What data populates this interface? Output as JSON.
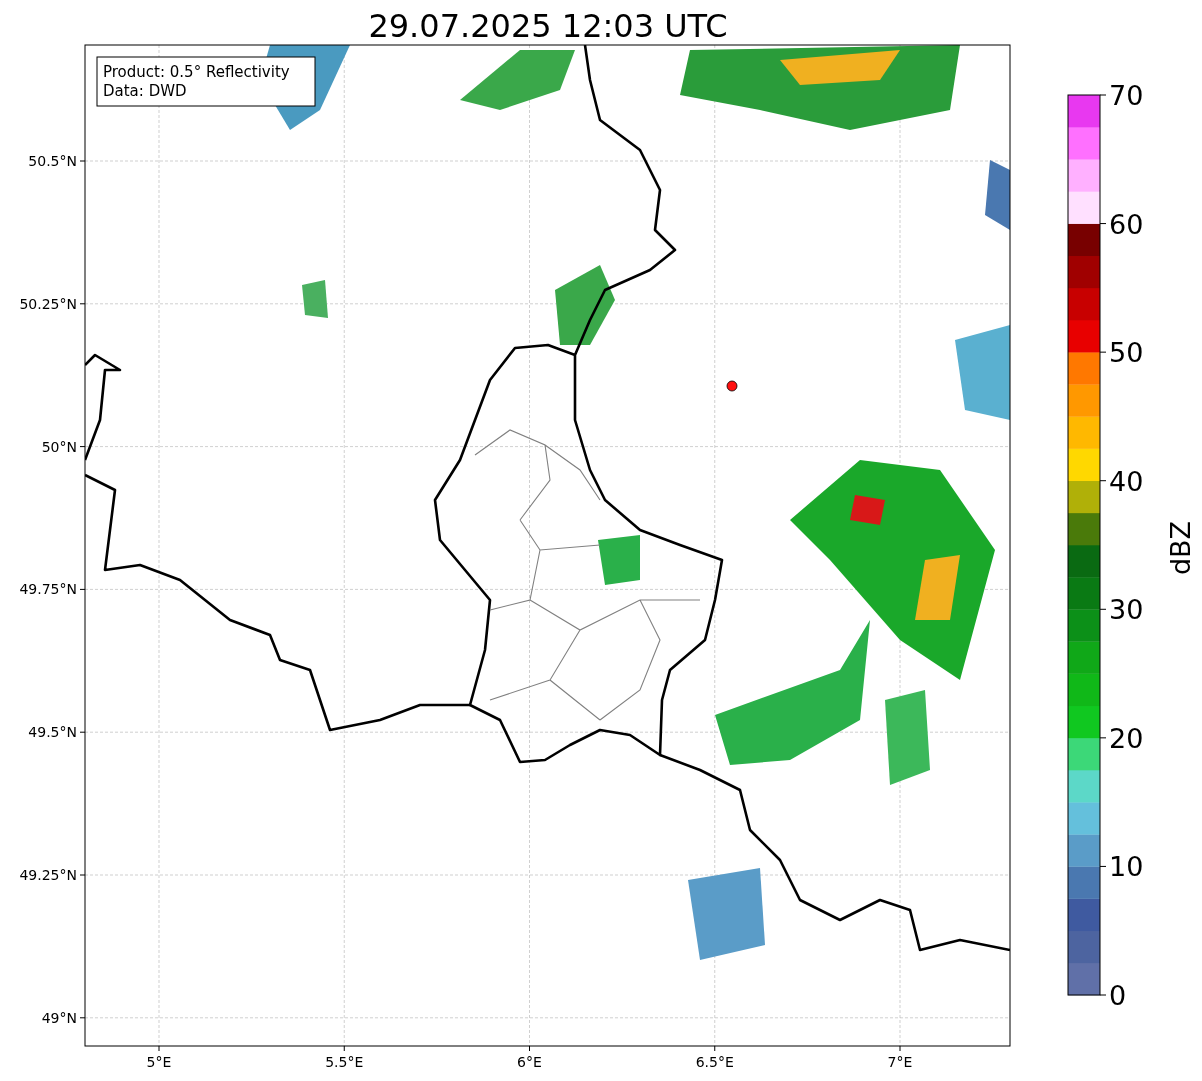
{
  "title": "29.07.2025 12:03 UTC",
  "map": {
    "annotation": [
      "Product: 0.5° Reflectivity",
      "Data: DWD"
    ],
    "x_ticks": [
      "5°E",
      "5.5°E",
      "6°E",
      "6.5°E",
      "7°E"
    ],
    "y_ticks": [
      "50.5°N",
      "50.25°N",
      "50°N",
      "49.75°N",
      "49.5°N",
      "49.25°N",
      "49°N"
    ]
  },
  "colorbar": {
    "label": "dBZ",
    "ticks": [
      "70",
      "60",
      "50",
      "40",
      "30",
      "20",
      "10",
      "0"
    ],
    "bands": [
      {
        "color": "#6070a8"
      },
      {
        "color": "#4d64a0"
      },
      {
        "color": "#3f5aa0"
      },
      {
        "color": "#4a78b0"
      },
      {
        "color": "#5a9cc8"
      },
      {
        "color": "#64c0dc"
      },
      {
        "color": "#5cd8c8"
      },
      {
        "color": "#3cd878"
      },
      {
        "color": "#10c820"
      },
      {
        "color": "#10b818"
      },
      {
        "color": "#10a818"
      },
      {
        "color": "#0c9018"
      },
      {
        "color": "#0a7a14"
      },
      {
        "color": "#0a6a12"
      },
      {
        "color": "#4a7a0a"
      },
      {
        "color": "#b0b008"
      },
      {
        "color": "#ffd800"
      },
      {
        "color": "#ffb800"
      },
      {
        "color": "#ff9800"
      },
      {
        "color": "#ff7800"
      },
      {
        "color": "#e80000"
      },
      {
        "color": "#c80000"
      },
      {
        "color": "#a00000"
      },
      {
        "color": "#780000"
      },
      {
        "color": "#ffe0ff"
      },
      {
        "color": "#ffb0ff"
      },
      {
        "color": "#ff70ff"
      },
      {
        "color": "#e838f0"
      }
    ]
  }
}
